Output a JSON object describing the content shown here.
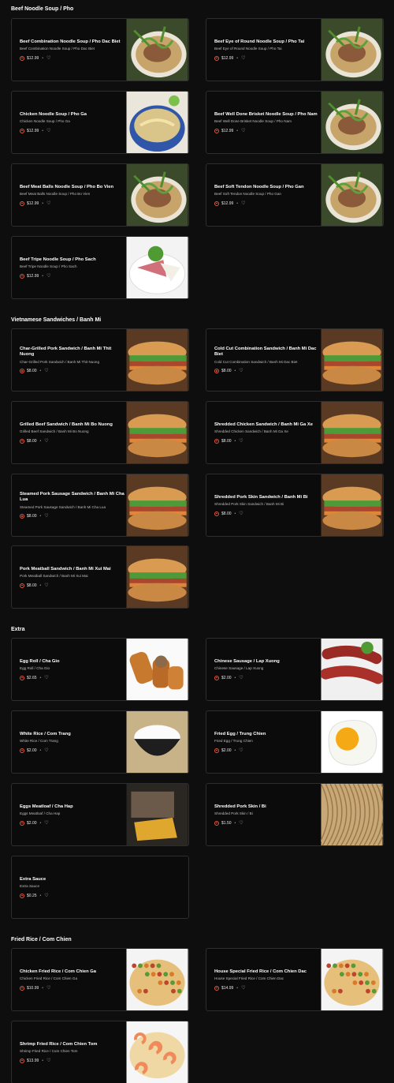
{
  "sections": [
    {
      "title": "Beef Noodle Soup / Pho"
    },
    {
      "title": "Vietnamese Sandwiches / Banh Mi"
    },
    {
      "title": "Extra"
    },
    {
      "title": "Fried Rice / Com Chien"
    }
  ],
  "items": [
    {
      "name": "Beef Combination Noodle Soup / Pho Dac Biet",
      "desc": "Beef Combination Noodle Soup / Pho Dac Biet",
      "price": "$12.99",
      "image": "pho-bowl-image"
    },
    {
      "name": "Beef Eye of Round Noodle Soup / Pho Tai",
      "desc": "Beef Eye of Round Noodle Soup / Pho Tai",
      "price": "$12.99",
      "image": "pho-bowl-image"
    },
    {
      "name": "Chicken Noodle Soup / Pho Ga",
      "desc": "Chicken Noodle Soup / Pho Ga",
      "price": "$12.99",
      "image": "chicken-pho-image"
    },
    {
      "name": "Beef Well Done Brisket Noodle Soup / Pho Nam",
      "desc": "Beef Well Done Brisket Noodle Soup / Pho Nam",
      "price": "$12.99",
      "image": "brisket-pho-image"
    },
    {
      "name": "Beef Meat Balls Noodle Soup / Pho Bo Vien",
      "desc": "Beef Meat Balls Noodle Soup / Pho Bo Vien",
      "price": "$12.99",
      "image": "meatball-pho-image"
    },
    {
      "name": "Beef Soft Tendon Noodle Soup / Pho Gan",
      "desc": "Beef Soft Tendon Noodle Soup / Pho Gan",
      "price": "$12.99",
      "image": "tendon-pho-image"
    },
    {
      "name": "Beef Tripe Noodle Soup / Pho Sach",
      "desc": "Beef Tripe Noodle Soup / Pho Sach",
      "price": "$12.99",
      "image": "tripe-pho-image"
    },
    {
      "name": "Char-Grilled Pork Sandwich / Banh Mi Thit Nuong",
      "desc": "Char-Grilled Pork Sandwich / Banh Mi Thit Nuong",
      "price": "$8.00",
      "image": "banh-mi-image"
    },
    {
      "name": "Cold Cut Combination Sandwich / Banh Mi Dac Biet",
      "desc": "Cold Cut Combination Sandwich / Banh Mi Dac Biet",
      "price": "$8.00",
      "image": "banh-mi-image"
    },
    {
      "name": "Grilled Beef Sandwich / Banh Mi Bo Nuong",
      "desc": "Grilled Beef Sandwich / Banh Mi Bo Nuong",
      "price": "$8.00",
      "image": "banh-mi-image"
    },
    {
      "name": "Shredded Chicken Sandwich / Banh Mi Ga Xe",
      "desc": "Shredded Chicken Sandwich / Banh Mi Ga Xe",
      "price": "$8.00",
      "image": "banh-mi-image"
    },
    {
      "name": "Steamed Pork Sausage Sandwich / Banh Mi Cha Lua",
      "desc": "Steamed Pork Sausage Sandwich / Banh Mi Cha Lua",
      "price": "$8.00",
      "image": "banh-mi-image"
    },
    {
      "name": "Shredded Pork Skin Sandwich / Banh Mi Bi",
      "desc": "Shredded Pork Skin Sandwich / Banh Mi Bi",
      "price": "$8.00",
      "image": "banh-mi-image"
    },
    {
      "name": "Pork Meatball Sandwich / Banh Mi Xui Mai",
      "desc": "Pork Meatball Sandwich / Banh Mi Xui Mai",
      "price": "$8.00",
      "image": "banh-mi-image"
    },
    {
      "name": "Egg Roll / Cha Gio",
      "desc": "Egg Roll / Cha Gio",
      "price": "$2.65",
      "image": "egg-roll-image"
    },
    {
      "name": "Chinese Sausage / Lap Xuong",
      "desc": "Chinese Sausage / Lap Xuong",
      "price": "$2.00",
      "image": "sausage-image"
    },
    {
      "name": "White Rice / Com Trang",
      "desc": "White Rice / Com Trang",
      "price": "$2.00",
      "image": "rice-bowl-image"
    },
    {
      "name": "Fried Egg / Trung Chien",
      "desc": "Fried Egg / Trung Chien",
      "price": "$2.00",
      "image": "fried-egg-image"
    },
    {
      "name": "Eggs Meatloaf / Cha Hap",
      "desc": "Eggs Meatloaf / Cha Hap",
      "price": "$2.00",
      "image": "meatloaf-image"
    },
    {
      "name": "Shredded Pork Skin / Bi",
      "desc": "Shredded Pork Skin / Bi",
      "price": "$1.50",
      "image": "pork-skin-image"
    },
    {
      "name": "Extra Sauce",
      "desc": "Extra Sauce",
      "price": "$0.25",
      "image": ""
    },
    {
      "name": "Chicken Fried Rice / Com Chien Ga",
      "desc": "Chicken Fried Rice / Com Chien Ga",
      "price": "$10.99",
      "image": "fried-rice-image"
    },
    {
      "name": "House Special Fried Rice / Com Chien Dac",
      "desc": "House Special Fried Rice / Com Chien Dac",
      "price": "$14.99",
      "image": "fried-rice-image"
    },
    {
      "name": "Shrimp Fried Rice / Com Chien Tom",
      "desc": "Shrimp Fried Rice / Com Chien Tom",
      "price": "$13.99",
      "image": "shrimp-fried-rice-image"
    }
  ],
  "labels": {
    "dot": "•",
    "heart": "♡"
  },
  "colors": {
    "background": "#0e0e0e",
    "card_border": "#2e2e2e",
    "price_icon": "#e8553e"
  }
}
